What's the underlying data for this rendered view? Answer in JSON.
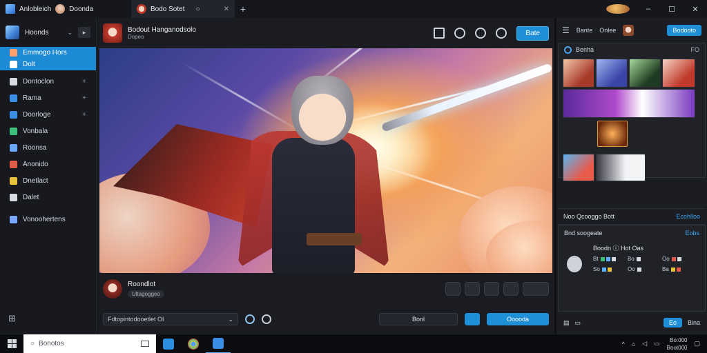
{
  "titlebar": {
    "app_tab_label": "Anlobleich",
    "app_tab_user": "Doonda",
    "doc_tab_label": "Bodo Sotet",
    "window_controls": [
      "–",
      "☐",
      "✕"
    ]
  },
  "sidebar": {
    "workspace_name": "Hoonds",
    "items": [
      {
        "label": "Emmogo Hors",
        "color": "#5fb0ff",
        "selected": true
      },
      {
        "label": "Dolt",
        "color": "#5fb0ff",
        "selected": true
      },
      {
        "label": "Dontoclon",
        "color": "#d8dbe2",
        "plus": "+"
      },
      {
        "label": "Rama",
        "color": "#3a8ee6",
        "plus": "+"
      },
      {
        "label": "Doorloge",
        "color": "#3a8ee6",
        "plus": "+"
      },
      {
        "label": "Vonbala",
        "color": "#3ec07a"
      },
      {
        "label": "Roonsa",
        "color": "#6aa8ff"
      },
      {
        "label": "Anonido",
        "color": "#e25b4a"
      },
      {
        "label": "Dnetlact",
        "color": "#e8c23a"
      },
      {
        "label": "Dalet",
        "color": "#d8dbe2"
      },
      {
        "label": "Vonoohertens",
        "color": "#7aa8ff"
      }
    ]
  },
  "center": {
    "title": "Bodout Hanganodsolo",
    "subtitle": "Dopeo",
    "share_label": "Bate",
    "author_name": "Roondlot",
    "author_tag": "Ultagoggeo",
    "input_value": "Fdtopintodooetlet OI",
    "input2_value": "Bonl",
    "primary_button": "Ooooda"
  },
  "right": {
    "tab1": "Bante",
    "tab2": "Onlee",
    "action_button": "Bodooto",
    "section_title": "Benha",
    "section_count": "FO",
    "mid_label": "Noo   Qcooggo Bott",
    "mid_link": "Ecohlloo",
    "box2_title": "Bnd soogeate",
    "box2_link": "Eobs",
    "box2_sub": "Boodn  ⓘ  Hot Oas",
    "mini_rows": [
      "Bt",
      "Bo",
      "Oo",
      "So",
      "Oo",
      "Ba"
    ],
    "foot_button": "Eo",
    "foot_right": "Bina"
  },
  "taskbar": {
    "search_placeholder": "Bonotos",
    "time": "Bo:000",
    "date": "Boot000"
  }
}
